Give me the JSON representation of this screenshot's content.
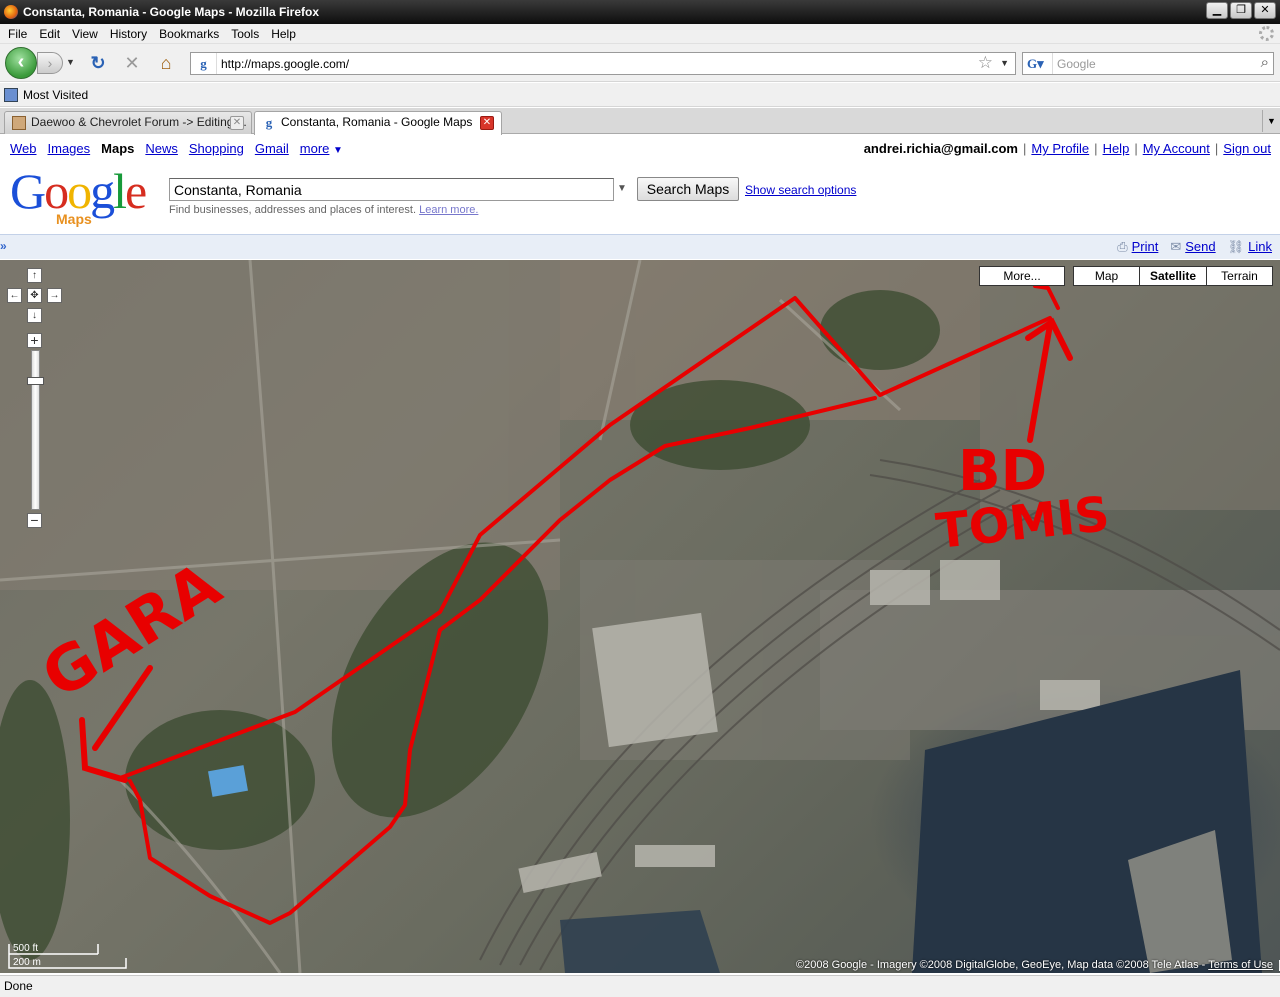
{
  "window": {
    "title": "Constanta, Romania - Google Maps - Mozilla Firefox"
  },
  "menu": [
    "File",
    "Edit",
    "View",
    "History",
    "Bookmarks",
    "Tools",
    "Help"
  ],
  "nav": {
    "url": "http://maps.google.com/",
    "search_placeholder": "Google"
  },
  "bookmarks": {
    "most_visited": "Most Visited"
  },
  "tabs": [
    {
      "label": "Daewoo & Chevrolet Forum -> Editing ..."
    },
    {
      "label": "Constanta, Romania - Google Maps"
    }
  ],
  "google_nav": {
    "links": [
      "Web",
      "Images",
      "Maps",
      "News",
      "Shopping",
      "Gmail",
      "more"
    ],
    "email": "andrei.richia@gmail.com",
    "account_links": [
      "My Profile",
      "Help",
      "My Account",
      "Sign out"
    ]
  },
  "header": {
    "logo_word": "Google",
    "logo_sub": "Maps",
    "search_value": "Constanta, Romania",
    "search_button": "Search Maps",
    "show_options": "Show search options",
    "hint": "Find businesses, addresses and places of interest.",
    "learn_more": "Learn more."
  },
  "toolstrip": {
    "print": "Print",
    "send": "Send",
    "link": "Link"
  },
  "map": {
    "types": [
      "Map",
      "Satellite",
      "Terrain"
    ],
    "more": "More...",
    "selected_type": "Satellite",
    "annotations": {
      "gara": "GARA",
      "bd": "BD",
      "tomis": "TOMIS"
    },
    "scale_ft": "500 ft",
    "scale_m": "200 m",
    "copyright": "©2008 Google - Imagery ©2008 DigitalGlobe, GeoEye, Map data ©2008 Tele Atlas -",
    "terms": "Terms of Use",
    "route_color": "#e80000"
  },
  "status": "Done"
}
